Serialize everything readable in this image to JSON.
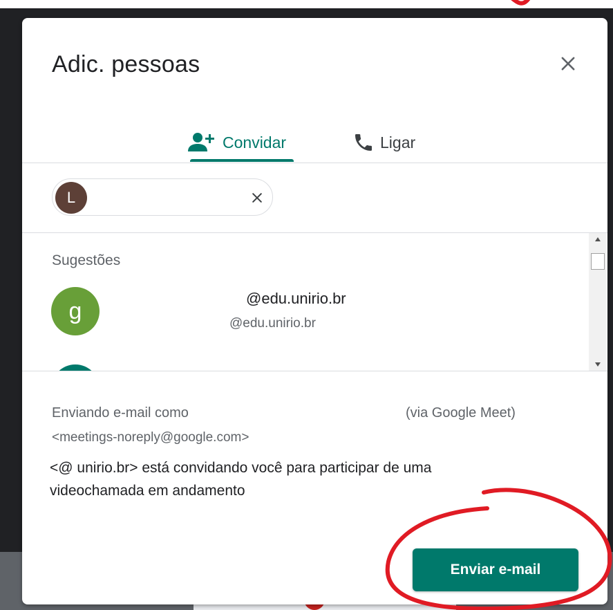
{
  "dialog": {
    "title": "Adic. pessoas",
    "close_icon": "close-icon"
  },
  "tabs": [
    {
      "label": "Convidar",
      "icon": "add-person-icon",
      "selected": true
    },
    {
      "label": "Ligar",
      "icon": "phone-icon",
      "selected": false
    }
  ],
  "recipient_chip": {
    "initial": "L",
    "avatar_color": "#5d4037",
    "remove_icon": "close-icon"
  },
  "suggestions": {
    "title": "Sugestões",
    "items": [
      {
        "initial": "g",
        "name": "@edu.unirio.br",
        "email": "@edu.unirio.br",
        "avatar_color": "#689f38"
      }
    ]
  },
  "footer": {
    "sending_label": "Enviando e-mail como",
    "sending_via": "(via Google Meet)",
    "sender_email": "<meetings-noreply@google.com>",
    "message": "<@ unirio.br> está convidando você para participar de uma videochamada em andamento",
    "send_button": "Enviar e-mail"
  },
  "colors": {
    "accent": "#00796b",
    "annotation": "#e01b24"
  }
}
